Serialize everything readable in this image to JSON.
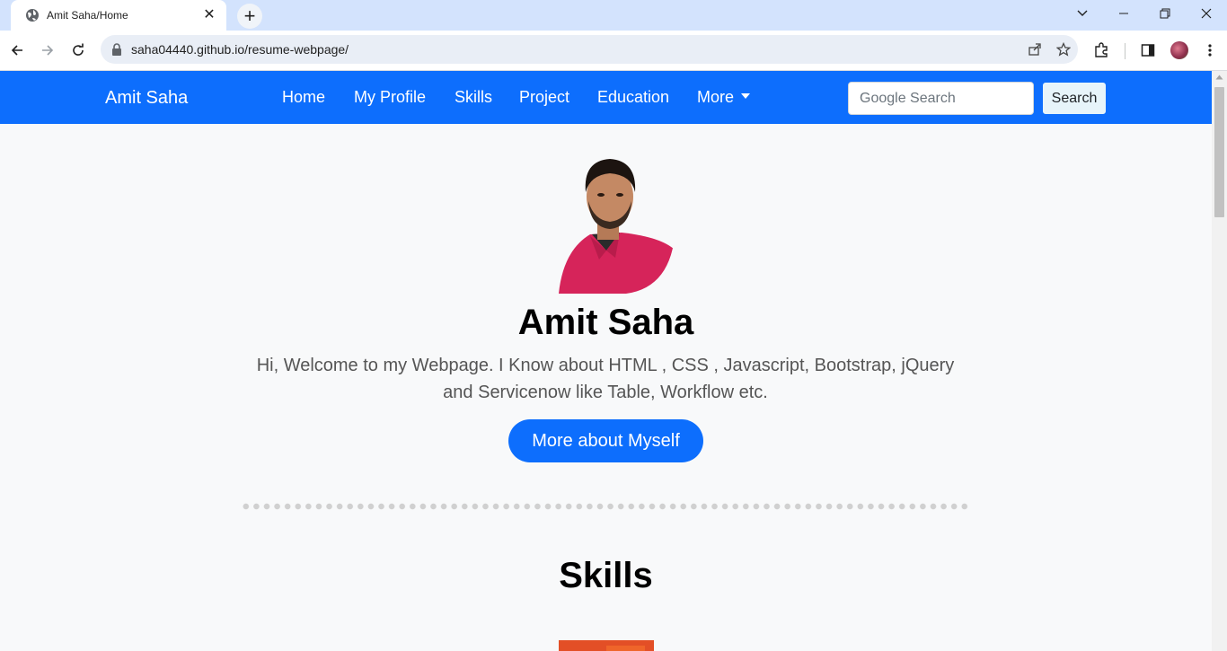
{
  "browser": {
    "tab_title": "Amit Saha/Home",
    "tab_close": "✕",
    "new_tab": "+",
    "url": "saha04440.github.io/resume-webpage/"
  },
  "site": {
    "brand": "Amit Saha",
    "nav": [
      "Home",
      "My Profile",
      "Skills",
      "Project",
      "Education",
      "More"
    ],
    "search_placeholder": "Google Search",
    "search_button": "Search"
  },
  "hero": {
    "name": "Amit Saha",
    "intro": "Hi, Welcome to my Webpage. I Know about HTML , CSS , Javascript, Bootstrap, jQuery and Servicenow like Table, Workflow etc.",
    "button": "More about Myself"
  },
  "skills": {
    "title": "Skills"
  },
  "colors": {
    "nav_bg": "#0d6efd",
    "page_bg": "#f8f9fa",
    "tabbar_bg": "#d3e3fd"
  }
}
